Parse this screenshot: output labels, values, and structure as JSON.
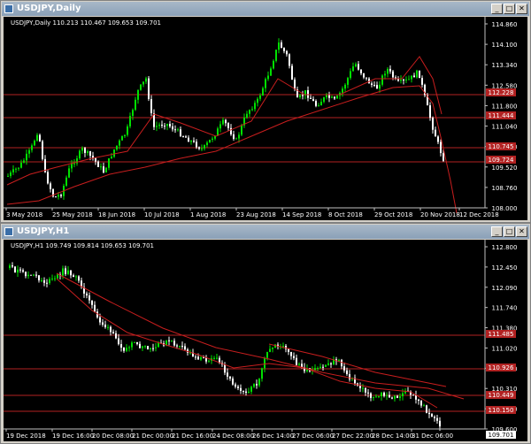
{
  "windows": [
    {
      "title": "USDJPY,Daily",
      "header": "USDJPY,Daily  110.213 110.467 109.653 109.701",
      "price_ticks": [
        "114.860",
        "114.100",
        "113.340",
        "112.580",
        "111.800",
        "111.040",
        "110.280",
        "109.520",
        "108.760",
        "108.000"
      ],
      "date_ticks": [
        "3 May 2018",
        "25 May 2018",
        "18 Jun 2018",
        "10 Jul 2018",
        "1 Aug 2018",
        "23 Aug 2018",
        "14 Sep 2018",
        "8 Oct 2018",
        "29 Oct 2018",
        "20 Nov 2018",
        "12 Dec 2018"
      ],
      "price_labels": [
        {
          "text": "112.228",
          "bg": "#b22222"
        },
        {
          "text": "111.444",
          "bg": "#b22222"
        },
        {
          "text": "110.745",
          "bg": "#b22222"
        },
        {
          "text": "109.724",
          "bg": "#b22222"
        }
      ]
    },
    {
      "title": "USDJPY,H1",
      "header": "USDJPY,H1  109.749 109.814 109.653 109.701",
      "price_ticks": [
        "112.800",
        "112.450",
        "112.090",
        "111.740",
        "111.380",
        "111.020",
        "110.670",
        "110.310",
        "109.950",
        "109.600"
      ],
      "date_ticks": [
        "19 Dec 2018",
        "19 Dec 16:00",
        "20 Dec 08:00",
        "21 Dec 00:00",
        "21 Dec 16:00",
        "24 Dec 08:00",
        "26 Dec 14:00",
        "27 Dec 06:00",
        "27 Dec 22:00",
        "28 Dec 14:00",
        "31 Dec 06:00"
      ],
      "price_labels": [
        {
          "text": "111.485",
          "bg": "#b22222"
        },
        {
          "text": "110.926",
          "bg": "#b22222"
        },
        {
          "text": "110.449",
          "bg": "#b22222"
        },
        {
          "text": "110.150",
          "bg": "#b22222"
        },
        {
          "text": "109.701",
          "bg": "#ffffff"
        }
      ]
    }
  ],
  "colors": {
    "bull": "#00e000",
    "bear": "#ffffff",
    "ma": "#c81e1e",
    "level": "#b22222",
    "grid": "#c0c0c0"
  }
}
